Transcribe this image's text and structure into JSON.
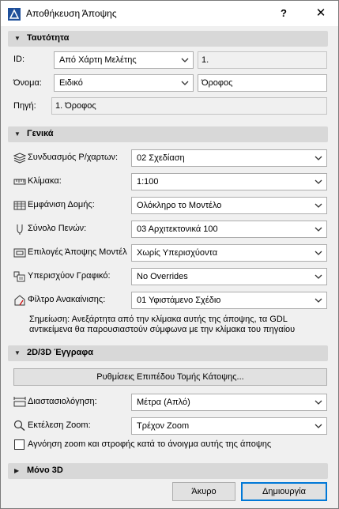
{
  "window": {
    "title": "Αποθήκευση Άποψης",
    "help": "?",
    "close": "✕"
  },
  "sections": {
    "identity": "Ταυτότητα",
    "general": "Γενικά",
    "docs2d3d": "2D/3D Έγγραφα",
    "only3d": "Μόνο 3D"
  },
  "identity": {
    "id_label": "ID:",
    "id_combo": "Από Χάρτη Μελέτης",
    "id_value": "1.",
    "name_label": "Όνομα:",
    "name_combo": "Ειδικό",
    "name_value": "Όροφος",
    "source_label": "Πηγή:",
    "source_value": "1. Όροφος"
  },
  "general": {
    "rows": [
      {
        "label": "Συνδυασμός Ρ/χαρτων:",
        "value": "02 Σχεδίαση"
      },
      {
        "label": "Κλίμακα:",
        "value": "1:100"
      },
      {
        "label": "Εμφάνιση Δομής:",
        "value": "Ολόκληρο το Μοντέλο"
      },
      {
        "label": "Σύνολο Πενών:",
        "value": "03 Αρχιτεκτονικά 100"
      },
      {
        "label": "Επιλογές Άποψης Μοντέλ",
        "value": "Χωρίς Υπερισχύοντα"
      },
      {
        "label": "Υπερισχύον Γραφικό:",
        "value": "No Overrides"
      },
      {
        "label": "Φίλτρο Ανακαίνισης:",
        "value": "01 Υφιστάμενο Σχέδιο"
      }
    ],
    "note": "Σημείωση: Ανεξάρτητα από την κλίμακα αυτής της άποψης, τα GDL αντικείμενα θα παρουσιαστούν σύμφωνα με την κλίμακα του πηγαίου"
  },
  "docs": {
    "section_settings_button": "Ρυθμίσεις Επιπέδου Τομής Κάτοψης...",
    "dimensioning_label": "Διαστασιολόγηση:",
    "dimensioning_value": "Μέτρα (Απλό)",
    "zoom_label": "Εκτέλεση Zoom:",
    "zoom_value": "Τρέχον Zoom",
    "ignore_zoom_label": "Αγνόηση zoom και στροφής κατά το άνοιγμα αυτής της άποψης",
    "ignore_zoom_checked": false
  },
  "footer": {
    "cancel": "Άκυρο",
    "create": "Δημιουργία"
  }
}
